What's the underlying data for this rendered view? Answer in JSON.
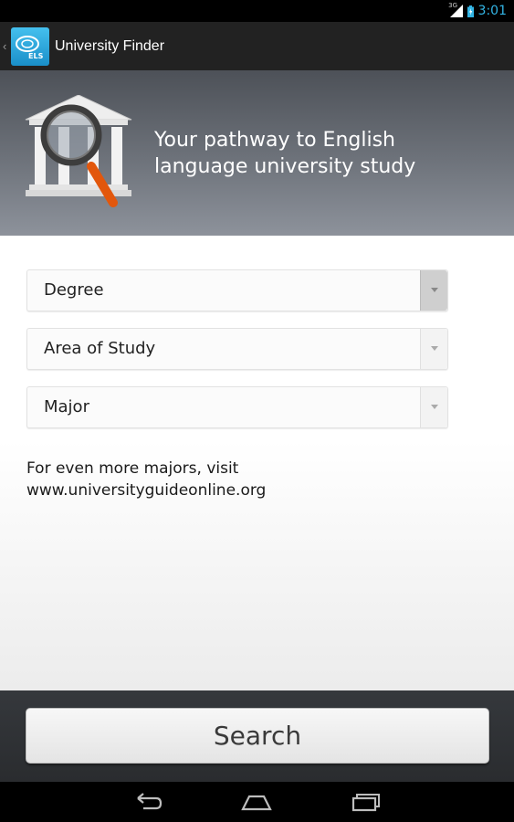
{
  "status_bar": {
    "network": "3G",
    "time": "3:01",
    "colors": {
      "time": "#33b5e5"
    }
  },
  "action_bar": {
    "title": "University Finder",
    "icon": "els-logo-icon",
    "icon_text": "ELS"
  },
  "hero": {
    "tagline_line1": "Your pathway to English",
    "tagline_line2": "language university study",
    "icon": "university-search-icon"
  },
  "filters": {
    "degree": {
      "selected": "Degree"
    },
    "area_of_study": {
      "selected": "Area of Study"
    },
    "major": {
      "selected": "Major"
    }
  },
  "more_info": {
    "line1": "For even more majors, visit",
    "line2": "www.universityguideonline.org"
  },
  "search_button": {
    "label": "Search"
  },
  "nav_bar": {
    "icons": [
      "back-icon",
      "home-icon",
      "recent-apps-icon"
    ]
  }
}
